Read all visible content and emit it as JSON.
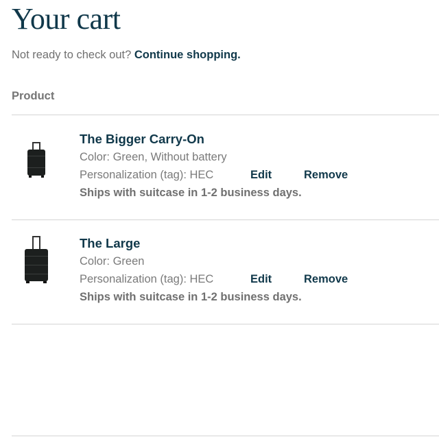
{
  "header": {
    "title": "Your cart",
    "subline_prefix": "Not ready to check out?",
    "continue_link": "Continue shopping."
  },
  "table": {
    "column_header": "Product"
  },
  "items": [
    {
      "name": "The Bigger Carry-On",
      "color": "Color: Green, Without battery",
      "personalization": "Personalization (tag): HEC",
      "edit_label": "Edit",
      "remove_label": "Remove",
      "shipping": "Ships with suitcase in 1-2 business days.",
      "image": "suitcase-carry-on-icon"
    },
    {
      "name": "The Large",
      "color": "Color: Green",
      "personalization": "Personalization (tag): HEC",
      "edit_label": "Edit",
      "remove_label": "Remove",
      "shipping": "Ships with suitcase in 1-2 business days.",
      "image": "suitcase-large-icon"
    }
  ],
  "colors": {
    "brand_text": "#10384a",
    "muted_text": "#757575",
    "divider": "#d4d4d4",
    "suitcase": "#1c1f1e"
  }
}
